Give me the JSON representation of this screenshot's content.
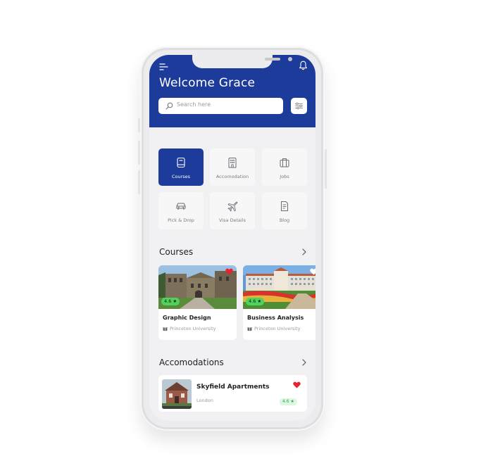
{
  "header": {
    "welcome": "Welcome Grace",
    "search_placeholder": "Search here"
  },
  "categories": [
    {
      "label": "Courses",
      "icon": "book-icon",
      "active": true
    },
    {
      "label": "Accomodation",
      "icon": "building-icon",
      "active": false
    },
    {
      "label": "Jobs",
      "icon": "briefcase-icon",
      "active": false
    },
    {
      "label": "Pick & Drop",
      "icon": "car-icon",
      "active": false
    },
    {
      "label": "Visa Details",
      "icon": "airplane-icon",
      "active": false
    },
    {
      "label": "Blog",
      "icon": "document-icon",
      "active": false
    }
  ],
  "courses": {
    "title": "Courses",
    "items": [
      {
        "title": "Graphic Design",
        "university": "Princeton University",
        "rating": "4.6 ★",
        "favorited": true
      },
      {
        "title": "Business Analysis",
        "university": "Princeton University",
        "rating": "4.6 ★",
        "favorited": false
      }
    ]
  },
  "accomodations": {
    "title": "Accomodations",
    "items": [
      {
        "title": "Skyfield Apartments",
        "location": "London",
        "rating": "4.6 ★",
        "favorited": true
      }
    ]
  },
  "colors": {
    "primary": "#1d3b9a",
    "heart": "#e8232f",
    "rating_green": "#4ed35d"
  }
}
